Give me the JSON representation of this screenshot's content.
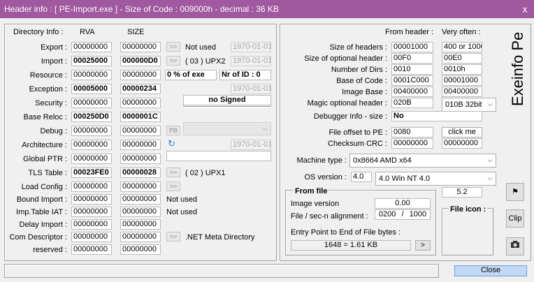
{
  "window": {
    "title": "Header info  : [ PE-Import.exe ] - Size of Code : 009000h - decimal : 36 KB",
    "close_glyph": "x"
  },
  "left": {
    "hdr_dirinfo": "Directory Info :",
    "hdr_rva": "RVA",
    "hdr_size": "SIZE",
    "rows": [
      {
        "label": "Export :",
        "rva": "00000000",
        "size": "00000000",
        "extra_btn": ">>",
        "extra_text": "Not used",
        "date": "1970-01-01"
      },
      {
        "label": "Import :",
        "rva": "00025000",
        "size": "000000D0",
        "extra_btn": ">>",
        "extra_text": "( 03 ) UPX2",
        "date": "1970-01-01"
      },
      {
        "label": "Resource :",
        "rva": "00000000",
        "size": "00000000",
        "pct": "0  % of exe",
        "nrid": "Nr of ID : 0"
      },
      {
        "label": "Exception :",
        "rva": "00005000",
        "size": "00000234",
        "date": "1970-01-01"
      },
      {
        "label": "Security :",
        "rva": "00000000",
        "size": "00000000",
        "signed": "no Signed"
      },
      {
        "label": "Base Reloc :",
        "rva": "000250D0",
        "size": "0000001C"
      },
      {
        "label": "Debug :",
        "rva": "00000000",
        "size": "00000000",
        "extra_btn": "PB"
      },
      {
        "label": "Architecture :",
        "rva": "00000000",
        "size": "00000000",
        "date": "1970-01-01"
      },
      {
        "label": "Global PTR :",
        "rva": "00000000",
        "size": "00000000"
      },
      {
        "label": "TLS Table :",
        "rva": "00023FE0",
        "size": "00000028",
        "extra_btn": ">>",
        "extra_text": "( 02 ) UPX1"
      },
      {
        "label": "Load Config :",
        "rva": "00000000",
        "size": "00000000",
        "extra_btn": ">>"
      },
      {
        "label": "Bound Import :",
        "rva": "00000000",
        "size": "00000000",
        "extra_text": "Not used"
      },
      {
        "label": "Imp.Table IAT :",
        "rva": "00000000",
        "size": "00000000",
        "extra_text": "Not used"
      },
      {
        "label": "Delay Import :",
        "rva": "00000000",
        "size": "00000000"
      },
      {
        "label": "Com Descriptor :",
        "rva": "00000000",
        "size": "00000000",
        "extra_btn": ">>",
        "extra_text": ".NET Meta Directory"
      },
      {
        "label": "reserved :",
        "rva": "00000000",
        "size": "00000000"
      }
    ]
  },
  "right": {
    "hdr_from": "From header :",
    "hdr_often": "Very often :",
    "side_title": "Exeinfo Pe",
    "rows": [
      {
        "label": "Size of headers :",
        "value": "00001000",
        "often": "400 or 1000"
      },
      {
        "label": "Size of optional header :",
        "value": "00F0",
        "often": "00E0"
      },
      {
        "label": "Number of Dirs :",
        "value": "0010",
        "often": "0010h"
      },
      {
        "label": "Base of Code :",
        "value": "0001C000",
        "often": "00001000"
      },
      {
        "label": "Image Base :",
        "value": "00400000",
        "often": "00400000"
      },
      {
        "label": "Magic optional header :",
        "value": "020B",
        "often": "010B 32bit"
      }
    ],
    "debugger_label": "Debugger Info  - size :",
    "debugger_value": "No",
    "file_offset_label": "File offset to PE :",
    "file_offset_value": "0080",
    "click_me": "click me",
    "checksum_label": "Checksum CRC :",
    "checksum_value": "00000000",
    "checksum_often": "00000000",
    "machine_label": "Machine type :",
    "machine_value": "0x8664  AMD x64",
    "os_label": "OS version :",
    "os_short": "4.0",
    "os_value": "4.0   Win NT 4.0",
    "linker": "5.2",
    "from_file": {
      "title": "From file",
      "image_version_label": "Image version",
      "image_version_value": "0.00",
      "align_label": "File / sec-n alignment  :",
      "file_align": "0200",
      "slash": "/",
      "sec_align": "1000",
      "entry_label": "Entry Point to End of File bytes :",
      "entry_value": "1648  =  1.61 KB",
      "entry_btn": ">"
    },
    "file_icon_label": "File icon :"
  },
  "side_buttons": {
    "clip": "Clip"
  },
  "footer": {
    "close": "Close"
  }
}
